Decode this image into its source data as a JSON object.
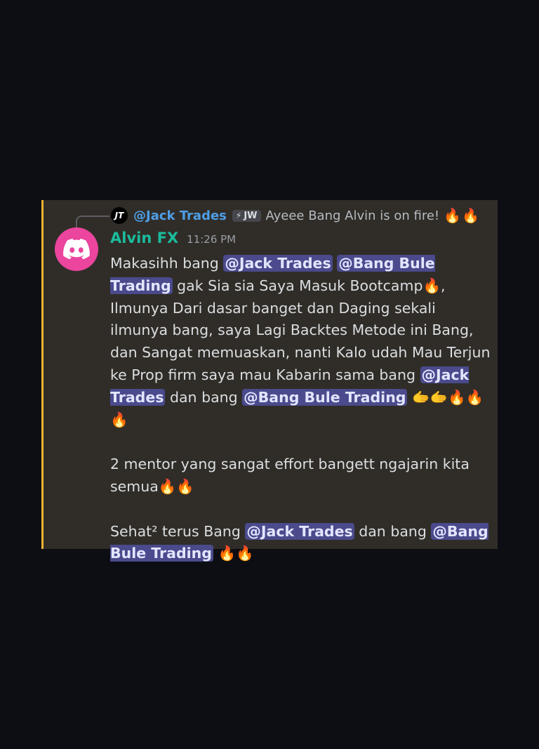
{
  "reply": {
    "avatar_text": "JT",
    "author": "@Jack Trades",
    "tag_icon": "⚡",
    "tag": "JW",
    "text": "Ayeee Bang Alvin is on fire!",
    "emojis": "🔥🔥"
  },
  "message": {
    "avatar_icon": "discord-logo-icon",
    "author": "Alvin FX",
    "time": "11:26 PM",
    "p1": {
      "t1": "Makasihh bang ",
      "m1": "@Jack Trades",
      "t2": "  ",
      "m2": "@Bang Bule Trading",
      "t3": " gak Sia sia Saya Masuk Bootcamp",
      "e1": "🔥",
      "t4": ", Ilmunya Dari dasar banget dan Daging sekali ilmunya bang, saya Lagi Backtes Metode ini Bang, dan Sangat memuaskan, nanti Kalo udah Mau Terjun ke Prop firm saya mau Kabarin sama bang ",
      "m3": "@Jack Trades",
      "t5": " dan bang ",
      "m4": "@Bang Bule Trading",
      "t6": " ",
      "e2": "🫱🫱🔥🔥🔥"
    },
    "p2": {
      "t1": "2 mentor yang sangat effort bangett ngajarin kita semua",
      "e1": "🔥🔥"
    },
    "p3": {
      "t1": "Sehat² terus Bang ",
      "m1": "@Jack Trades",
      "t2": "  dan bang ",
      "m2": "@Bang Bule Trading",
      "t3": " ",
      "e1": "🔥🔥"
    }
  },
  "colors": {
    "background": "#0c0e13",
    "card": "#302d28",
    "accent_bar": "#f0b232",
    "author": "#1abc9c",
    "reply_author": "#4e9ee6",
    "mention_bg": "#4a4a8c",
    "avatar": "#eb459e"
  }
}
